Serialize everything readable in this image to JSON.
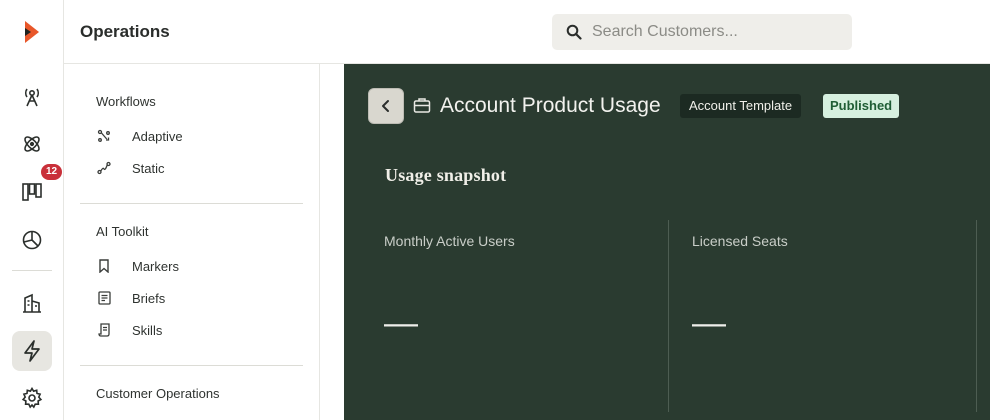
{
  "header": {
    "title": "Operations",
    "search_placeholder": "Search Customers..."
  },
  "rail": {
    "icons": [
      "logo-icon",
      "broadcast-tower-icon",
      "atom-icon",
      "board-icon",
      "pie-chart-icon",
      "building-icon",
      "lightning-icon",
      "gear-icon"
    ],
    "active": "lightning-icon",
    "badge_count": "12",
    "brand_color": "#e8572a"
  },
  "subnav": {
    "sections": [
      {
        "title": "Workflows",
        "items": [
          {
            "label": "Adaptive",
            "icon": "adaptive-icon"
          },
          {
            "label": "Static",
            "icon": "static-path-icon"
          }
        ]
      },
      {
        "title": "AI Toolkit",
        "items": [
          {
            "label": "Markers",
            "icon": "bookmark-icon"
          },
          {
            "label": "Briefs",
            "icon": "document-icon"
          },
          {
            "label": "Skills",
            "icon": "scroll-icon"
          }
        ]
      },
      {
        "title": "Customer Operations",
        "items": []
      }
    ]
  },
  "main": {
    "title": "Account Product Usage",
    "tag_template": "Account Template",
    "tag_status": "Published",
    "section_heading": "Usage snapshot",
    "metrics": [
      {
        "label": "Monthly Active Users",
        "value": "—"
      },
      {
        "label": "Licensed Seats",
        "value": "—"
      }
    ],
    "background_color": "#2a3b30",
    "status_color": "#d6f0df"
  }
}
